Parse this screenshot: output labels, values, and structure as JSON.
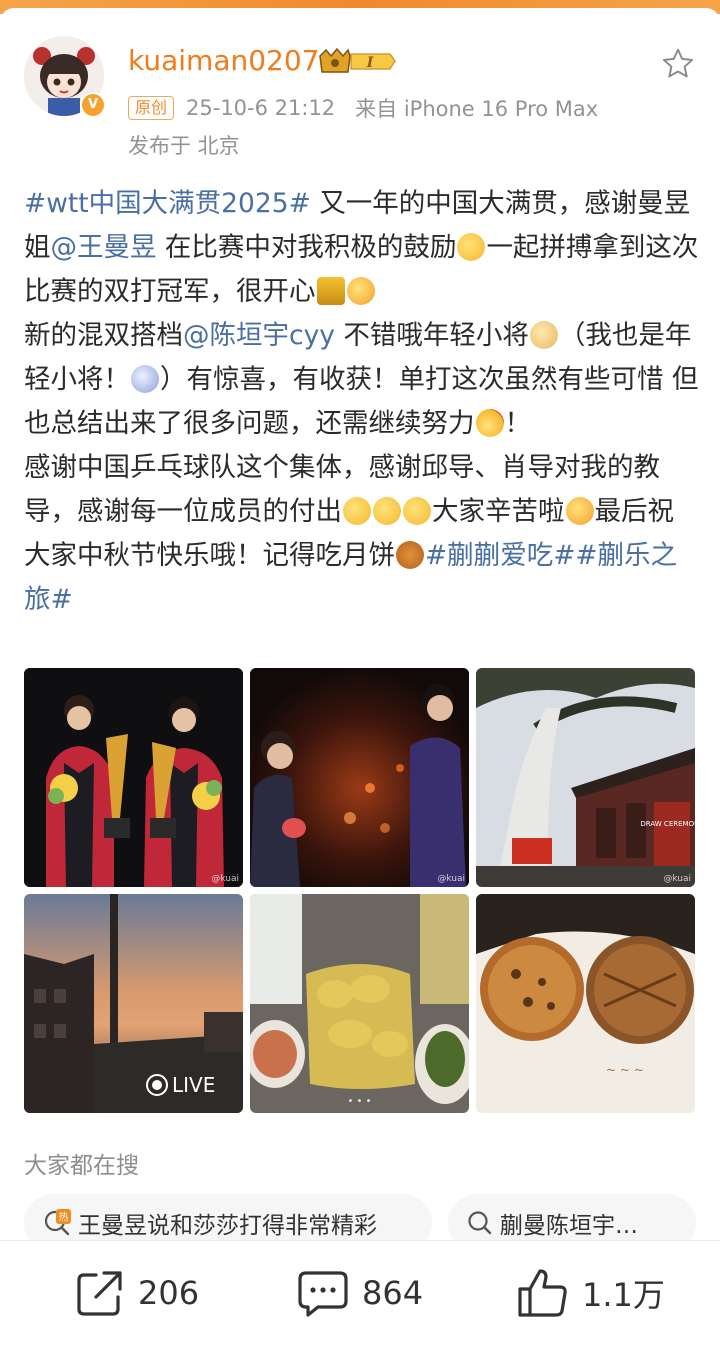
{
  "post": {
    "username": "kuaiman0207",
    "level": "I",
    "original_badge": "原创",
    "time": "25-10-6 21:12",
    "source": "来自 iPhone 16 Pro Max",
    "location": "发布于 北京",
    "text": {
      "tag1": "#wtt中国大满贯2025#",
      "t1": " 又一年的中国大满贯，感谢曼昱姐",
      "mention1": "@王曼昱",
      "t2": " 在比赛中对我积极的鼓励",
      "t3": "一起拼搏拿到这次比赛的双打冠军，很开心",
      "t4": "新的混双搭档",
      "mention2": "@陈垣宇cyy",
      "t5": " 不错哦年轻小将",
      "t6": "（我也是年轻小将！",
      "t7": "）有惊喜，有收获！单打这次虽然有些可惜 但也总结出来了很多问题，还需继续努力",
      "t8": "！",
      "t9": "感谢中国乒乓球队这个集体，感谢邱导、肖导对我的教导，感谢每一位成员的付出",
      "t10": "大家辛苦啦",
      "t11": "最后祝大家中秋节快乐哦！记得吃月饼",
      "tag2": "#蒯蒯爱吃#",
      "tag3": "#蒯乐之旅#"
    },
    "images": [
      {
        "icon": "trophy-ceremony-photo",
        "watermark": "@kuai"
      },
      {
        "icon": "match-photo",
        "watermark": "@kuai"
      },
      {
        "icon": "draw-ceremony-photo",
        "watermark": "@kuai",
        "sign": "DRAW CEREMONY"
      },
      {
        "icon": "sunset-photo",
        "live_label": "LIVE"
      },
      {
        "icon": "food-photo"
      },
      {
        "icon": "mooncake-photo"
      }
    ]
  },
  "search": {
    "heading": "大家都在搜",
    "items": [
      {
        "icon": "hot-search-icon",
        "label": "王曼昱说和莎莎打得非常精彩"
      },
      {
        "icon": "search-icon",
        "label": "蒯曼陈垣宇…"
      }
    ]
  },
  "actions": {
    "repost_count": "206",
    "comment_count": "864",
    "like_count": "1.1万"
  },
  "colors": {
    "accent": "#f07c1c",
    "link": "#4a6fa5",
    "meta": "#939393"
  }
}
